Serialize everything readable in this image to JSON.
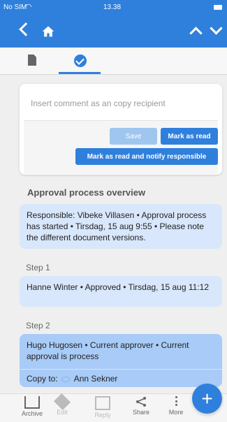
{
  "status": {
    "carrier": "No SIM",
    "time": "13.38"
  },
  "comment": {
    "placeholder": "Insert comment as an copy recipient"
  },
  "buttons": {
    "save": "Save",
    "mark_read": "Mark as read",
    "mark_read_notify": "Mark as read and notify responsible"
  },
  "overview_title": "Approval process overview",
  "cards": {
    "responsible": "Responsible: Vibeke Villasen • Approval process has started • Tirsdag, 15 aug 9:55 • Please note the different document versions.",
    "step1_label": "Step 1",
    "step1": "Hanne Winter • Approved • Tirsdag, 15 aug 11:12",
    "step2_label": "Step 2",
    "step2": "Hugo Hugosen • Current approver • Current approval is process",
    "copy_label": "Copy to:",
    "copy_name": "Ann Sekner"
  },
  "bottom": {
    "archive": "Archive",
    "edit": "Edit",
    "reply": "Reply",
    "share": "Share",
    "more": "More"
  },
  "fab": "+",
  "colors": {
    "accent": "#2f80dc",
    "card": "#d8e7fb",
    "active_card": "#a9cbf7"
  }
}
